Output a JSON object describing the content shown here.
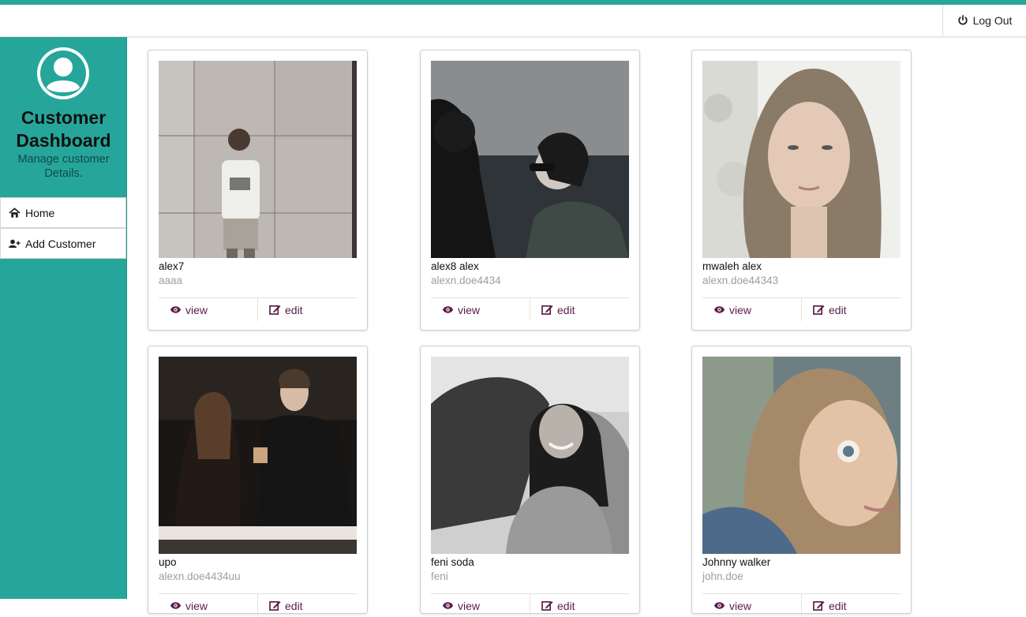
{
  "header": {
    "logout_label": "Log Out",
    "logout_icon": "power-icon"
  },
  "sidebar": {
    "title": "Customer Dashboard",
    "subtitle": "Manage customer Details.",
    "avatar_icon": "user-avatar-icon",
    "items": [
      {
        "label": "Home",
        "icon": "home-icon"
      },
      {
        "label": "Add Customer",
        "icon": "user-plus-icon"
      }
    ]
  },
  "colors": {
    "accent": "#26a69a",
    "action_text": "#5b1c49",
    "muted_text": "#9e9e9e"
  },
  "actions": {
    "view_label": "view",
    "edit_label": "edit"
  },
  "customers": [
    {
      "name": "alex7",
      "email": "aaaa"
    },
    {
      "name": "alex8 alex",
      "email": "alexn.doe4434"
    },
    {
      "name": "mwaleh alex",
      "email": "alexn.doe44343"
    },
    {
      "name": "upo",
      "email": "alexn.doe4434uu"
    },
    {
      "name": "feni soda",
      "email": "feni"
    },
    {
      "name": "Johnny walker",
      "email": "john.doe"
    }
  ]
}
